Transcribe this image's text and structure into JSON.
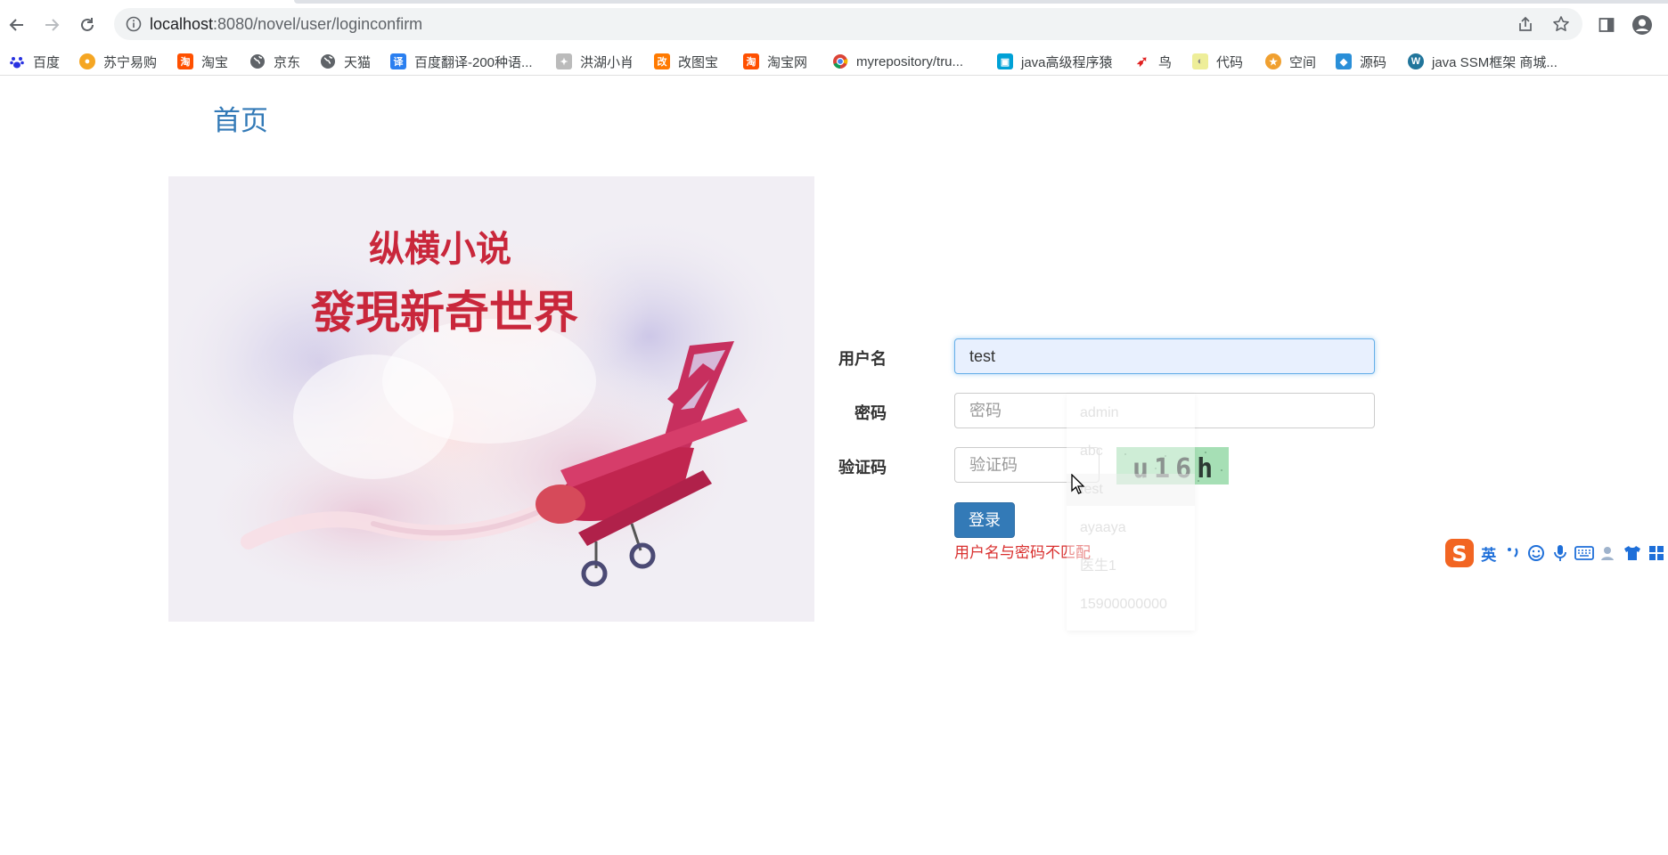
{
  "browser": {
    "url_host": "localhost",
    "url_path": ":8080/novel/user/loginconfirm",
    "icons": [
      "back-arrow-icon",
      "forward-arrow-icon",
      "reload-icon",
      "site-info-icon",
      "share-icon",
      "star-icon",
      "side-panel-icon",
      "profile-icon"
    ]
  },
  "bookmarks": [
    {
      "label": "百度",
      "icon": "baidu-paw-icon",
      "color": "#2932e1"
    },
    {
      "label": "苏宁易购",
      "icon": "suning-lion-icon",
      "color": "#f5a623"
    },
    {
      "label": "淘宝",
      "icon": "taobao-icon",
      "color": "#ff5000"
    },
    {
      "label": "京东",
      "icon": "globe-icon",
      "color": "#5f6368"
    },
    {
      "label": "天猫",
      "icon": "globe-icon",
      "color": "#5f6368"
    },
    {
      "label": "百度翻译-200种语...",
      "icon": "translate-icon",
      "color": "#2a7ff0"
    },
    {
      "label": "洪湖小肖",
      "icon": "bird-icon",
      "color": "#888888"
    },
    {
      "label": "改图宝",
      "icon": "gaitubao-icon",
      "color": "#ff7a00"
    },
    {
      "label": "淘宝网",
      "icon": "taobao-icon",
      "color": "#ff5000"
    },
    {
      "label": "myrepository/tru...",
      "icon": "chrome-icon",
      "color": "#db4437"
    },
    {
      "label": "java高级程序猿",
      "icon": "bilibili-icon",
      "color": "#00a1d6"
    },
    {
      "label": "鸟",
      "icon": "bird-red-icon",
      "color": "#e02020"
    },
    {
      "label": "代码",
      "icon": "leaf-icon",
      "color": "#c8c800"
    },
    {
      "label": "空间",
      "icon": "qzone-icon",
      "color": "#f0a030"
    },
    {
      "label": "源码",
      "icon": "fish-icon",
      "color": "#2a8fd8"
    },
    {
      "label": "java SSM框架 商城...",
      "icon": "wordpress-icon",
      "color": "#21759b"
    }
  ],
  "page": {
    "home_link": "首页",
    "form": {
      "username_label": "用户名",
      "username_value": "test",
      "password_label": "密码",
      "password_placeholder": "密码",
      "captcha_label": "验证码",
      "captcha_placeholder": "验证码",
      "captcha_text": "u16h",
      "login_button": "登录",
      "error_message": "用户名与密码不匹配"
    },
    "banner": {
      "line1": "纵横小说",
      "line2": "發現新奇世界"
    },
    "autocomplete": [
      "admin",
      "abc",
      "test",
      "ayaaya",
      "医生1",
      "15900000000"
    ]
  },
  "ime": {
    "logo": "S",
    "mode": "英",
    "icons": [
      "punctuation-icon",
      "emoji-icon",
      "microphone-icon",
      "keyboard-icon",
      "user-icon",
      "skin-shirt-icon",
      "grid-menu-icon"
    ]
  },
  "colors": {
    "link": "#337ab7",
    "primary_button": "#337ab7",
    "error": "#d9302f",
    "captcha_bg": "#a6dfb5"
  }
}
